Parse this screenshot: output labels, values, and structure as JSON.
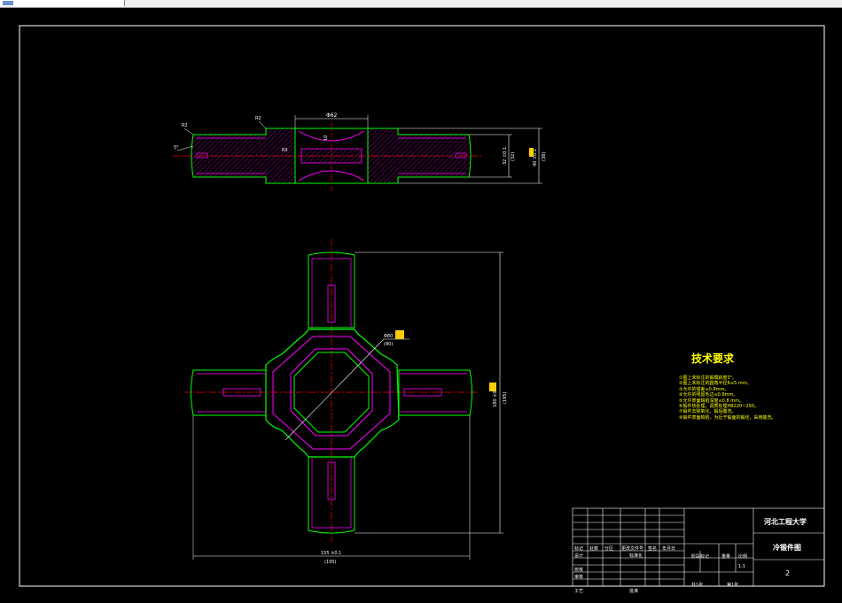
{
  "window": {
    "tab_label": ""
  },
  "drawing": {
    "colors": {
      "background": "#000000",
      "frame": "#ffffff",
      "outline": "#00ff00",
      "section": "#ff00ff",
      "center": "#ff0000",
      "dim": "#ffffff",
      "accent": "#ffcc00"
    },
    "top_view": {
      "dim_phi62": "Φ62",
      "dim_r2_left": "R2",
      "dim_r2_mid": "R2",
      "dim_10": "10",
      "dim_r5": "R5",
      "dim_angle": "5°",
      "dim_32": "32 ±0.1",
      "dim_32b": "(32)",
      "dim_38": "40 ±0.1",
      "dim_38b": "(38)"
    },
    "front_view": {
      "dim_phi80": "Φ80",
      "dim_phi80b": "(80)",
      "dim_height": "180 ±0.1",
      "dim_height_b": "(195)",
      "dim_width": "155 ±0.1",
      "dim_width_b": "(195)"
    }
  },
  "tech_requirements": {
    "title": "技术要求",
    "items": [
      "①图上未标注的锻模斜度3°。",
      "②图上未标注的圆角半径R≤5 mm。",
      "③允许的错差≤0.8mm。",
      "④允许的残留毛边≤0.8mm。",
      "⑤允许表面缺陷深度≤0.8 mm。",
      "⑥锻件热处理，调质处理HB220~250。",
      "⑦锻件去除氧化，锻后酸洗。",
      "⑧锻件表面缺陷，为近于锻面的锻坯，采用酸洗。"
    ]
  },
  "title_block": {
    "school": "河北工程大学",
    "drawing_name": "冷锻件图",
    "scale_value": "1:1",
    "sheet_no": "2",
    "headers": [
      "标记",
      "处数",
      "分区",
      "更改文件号",
      "签名",
      "年月日"
    ],
    "stage_label": "阶段标记",
    "weight_label": "重量",
    "scale_label": "比例",
    "rows_left": [
      "设计",
      "审核",
      "工艺"
    ],
    "check_label": "校核",
    "std_label": "标准化",
    "approve_label": "批准",
    "sheet_total": "共1张",
    "sheet_current": "第1张"
  }
}
